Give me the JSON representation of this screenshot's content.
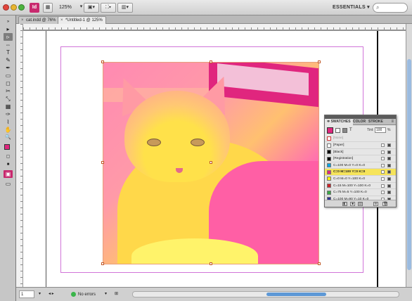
{
  "app": {
    "zoom": "125%",
    "workspace": "ESSENTIALS ▾",
    "app_icon_label": "Id"
  },
  "tabs": [
    {
      "label": "cat.indd @ 76%"
    },
    {
      "label": "*Untitled-1 @ 125%"
    }
  ],
  "tools": [
    "▸",
    "▹",
    "⇔",
    "T",
    "✎",
    "✒",
    "▭",
    "◻",
    "✂",
    "⤡",
    "▦",
    "✑",
    "✋",
    "🔍"
  ],
  "statusbar": {
    "page": "1",
    "status": "No errors"
  },
  "swatches": {
    "tabs": [
      "≑ SWATCHES",
      "COLOR",
      "STROKE"
    ],
    "tint_label": "Tint:",
    "tint_value": "100",
    "tint_unit": "%",
    "none_label": "[None]",
    "items": [
      {
        "name": "[Paper]",
        "color": "#ffffff"
      },
      {
        "name": "[Black]",
        "color": "#000000"
      },
      {
        "name": "[Registration]",
        "color": "#000000"
      },
      {
        "name": "C=100 M=0 Y=0 K=0",
        "color": "#00a4e4"
      },
      {
        "name": "C=0 M=100 Y=0 K=0",
        "color": "#e0267e",
        "selected": true
      },
      {
        "name": "C=0 M=0 Y=100 K=0",
        "color": "#fff200"
      },
      {
        "name": "C=15 M=100 Y=100 K=0",
        "color": "#cc2229"
      },
      {
        "name": "C=75 M=5 Y=100 K=0",
        "color": "#3ba847"
      },
      {
        "name": "C=100 M=90 Y=10 K=0",
        "color": "#2e3192"
      }
    ]
  },
  "colors": {
    "accent": "#e0267e",
    "margin_guide": "#d174d8",
    "selection_handle": "#c15a2a"
  }
}
